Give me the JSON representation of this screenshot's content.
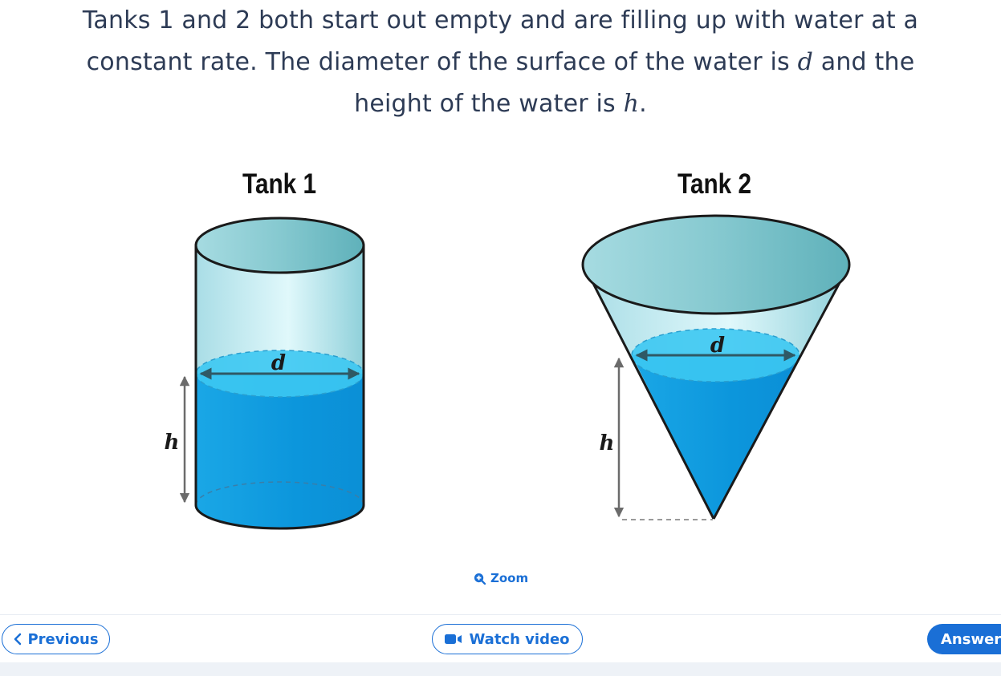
{
  "question": {
    "line1": "Tanks 1 and 2 both start out empty and are filling up with water at a",
    "line2_pre": "constant rate. The diameter of the surface of the water is ",
    "line2_var": "d",
    "line2_post": " and the",
    "line3_pre": "height of the water is ",
    "line3_var": "h",
    "line3_post": "."
  },
  "figure": {
    "tank1_title": "Tank 1",
    "tank2_title": "Tank 2",
    "diameter_label": "d",
    "height_label": "h",
    "colors": {
      "water_dark": "#0f9ee3",
      "water_surface": "#3cc8f2",
      "glass_light": "#d8f4f8",
      "rim": "#7cc3c9",
      "outline": "#1a1a1a",
      "arrow_dark": "#2f5965",
      "height_arrow": "#6b6b6b"
    }
  },
  "zoom": {
    "label": "Zoom",
    "icon": "zoom-in-icon"
  },
  "nav": {
    "previous_label": "Previous",
    "previous_icon": "chevron-left-icon",
    "video_label": "Watch video",
    "video_icon": "video-camera-icon",
    "answer_label": "Answer",
    "accent": "#1a6fd6"
  }
}
